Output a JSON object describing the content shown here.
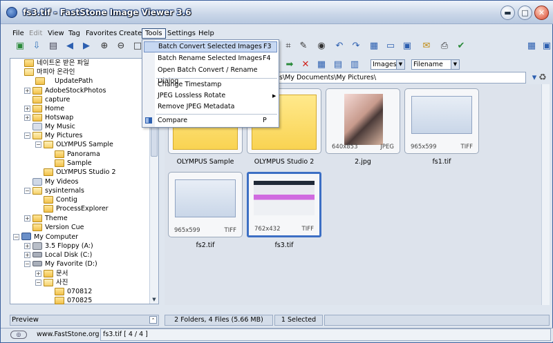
{
  "window": {
    "title": "fs3.tif  -  FastStone Image Viewer 3.6"
  },
  "menubar": {
    "items": [
      "File",
      "Edit",
      "View",
      "Tag",
      "Favorites",
      "Create",
      "Tools",
      "Settings",
      "Help"
    ]
  },
  "tools_menu": {
    "items": [
      {
        "label": "Batch Convert Selected Images",
        "shortcut": "F3"
      },
      {
        "label": "Batch Rename Selected Images",
        "shortcut": "F4"
      },
      {
        "label": "Open Batch Convert / Rename Dialog",
        "shortcut": ""
      },
      {
        "label": "Change Timestamp",
        "shortcut": ""
      },
      {
        "label": "JPEG Lossless Rotate",
        "shortcut": ""
      },
      {
        "label": "Remove JPEG Metadata",
        "shortcut": ""
      },
      {
        "label": "Compare",
        "shortcut": "P"
      }
    ]
  },
  "tree": {
    "nodes": [
      {
        "label": "네이트온 받은 파일"
      },
      {
        "label": "마피아 온라인"
      },
      {
        "label": "UpdatePath"
      },
      {
        "label": "AdobeStockPhotos"
      },
      {
        "label": "capture"
      },
      {
        "label": "Home"
      },
      {
        "label": "Hotswap"
      },
      {
        "label": "My Music"
      },
      {
        "label": "My Pictures"
      },
      {
        "label": "OLYMPUS Sample"
      },
      {
        "label": "Panorama"
      },
      {
        "label": "Sample"
      },
      {
        "label": "OLYMPUS Studio 2"
      },
      {
        "label": "My Videos"
      },
      {
        "label": "sysinternals"
      },
      {
        "label": "Contig"
      },
      {
        "label": "ProcessExplorer"
      },
      {
        "label": "Theme"
      },
      {
        "label": "Version Cue"
      },
      {
        "label": "My Computer"
      },
      {
        "label": "3.5 Floppy (A:)"
      },
      {
        "label": "Local Disk (C:)"
      },
      {
        "label": "My Favorite (D:)"
      },
      {
        "label": "문서"
      },
      {
        "label": "사진"
      },
      {
        "label": "070812"
      },
      {
        "label": "070825"
      }
    ]
  },
  "preview": {
    "label": "Preview"
  },
  "filter": {
    "type": "Images",
    "sort": "Filename"
  },
  "path": {
    "value": "s\\My Documents\\My Pictures\\"
  },
  "thumbnails": [
    {
      "name": "OLYMPUS Sample",
      "dim": "",
      "fmt": ""
    },
    {
      "name": "OLYMPUS Studio 2",
      "dim": "",
      "fmt": ""
    },
    {
      "name": "2.jpg",
      "dim": "640x853",
      "fmt": "JPEG"
    },
    {
      "name": "fs1.tif",
      "dim": "965x599",
      "fmt": "TIFF"
    },
    {
      "name": "fs2.tif",
      "dim": "965x599",
      "fmt": "TIFF"
    },
    {
      "name": "fs3.tif",
      "dim": "762x432",
      "fmt": "TIFF"
    }
  ],
  "status": {
    "summary": "2 Folders, 4 Files (5.66 MB)",
    "selected": "1 Selected"
  },
  "bottom": {
    "site": "www.FastStone.org",
    "file": "fs3.tif [ 4 / 4 ]"
  }
}
